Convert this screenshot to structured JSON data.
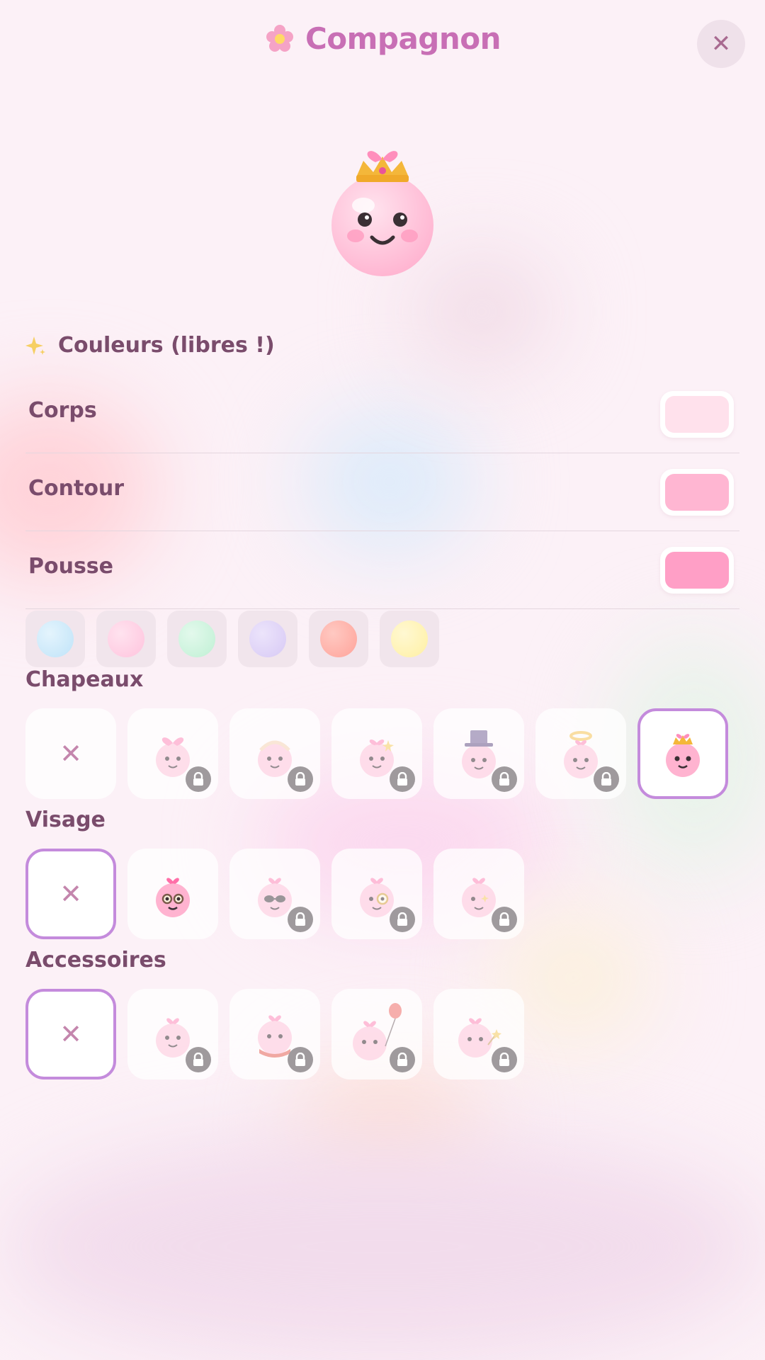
{
  "header": {
    "title": "Compagnon",
    "title_icon": "flower-icon",
    "close_label": "✕"
  },
  "avatar": {
    "hat": "crown",
    "body_color": "#ffc6dc"
  },
  "colors_section": {
    "title": "Couleurs (libres !)",
    "icon": "sparkle-icon",
    "rows": [
      {
        "label": "Corps",
        "color": "#ffe1ec"
      },
      {
        "label": "Contour",
        "color": "#ffb6d2"
      },
      {
        "label": "Pousse",
        "color": "#ff9fc6"
      }
    ],
    "presets": [
      "#bfe3f8",
      "#ffc3dd",
      "#bff0d4",
      "#d7c9f5",
      "#ffa39a",
      "#fff0a3"
    ]
  },
  "categories": {
    "hats": {
      "title": "Chapeaux",
      "items": [
        {
          "id": "none",
          "selected": false,
          "locked": false
        },
        {
          "id": "bow",
          "selected": false,
          "locked": true
        },
        {
          "id": "headband",
          "selected": false,
          "locked": true
        },
        {
          "id": "star-clip",
          "selected": false,
          "locked": true
        },
        {
          "id": "top-hat",
          "selected": false,
          "locked": true
        },
        {
          "id": "halo",
          "selected": false,
          "locked": true
        },
        {
          "id": "crown",
          "selected": true,
          "locked": false
        }
      ]
    },
    "face": {
      "title": "Visage",
      "items": [
        {
          "id": "none",
          "selected": true,
          "locked": false
        },
        {
          "id": "round-glasses",
          "selected": false,
          "locked": false
        },
        {
          "id": "sunglasses",
          "selected": false,
          "locked": true
        },
        {
          "id": "monocle",
          "selected": false,
          "locked": true
        },
        {
          "id": "star-eye",
          "selected": false,
          "locked": true
        }
      ]
    },
    "accessories": {
      "title": "Accessoires",
      "items": [
        {
          "id": "none",
          "selected": true,
          "locked": false
        },
        {
          "id": "bow-tie",
          "selected": false,
          "locked": true
        },
        {
          "id": "scarf",
          "selected": false,
          "locked": true
        },
        {
          "id": "balloon",
          "selected": false,
          "locked": true
        },
        {
          "id": "wand",
          "selected": false,
          "locked": true
        }
      ]
    }
  },
  "none_label": "✕"
}
